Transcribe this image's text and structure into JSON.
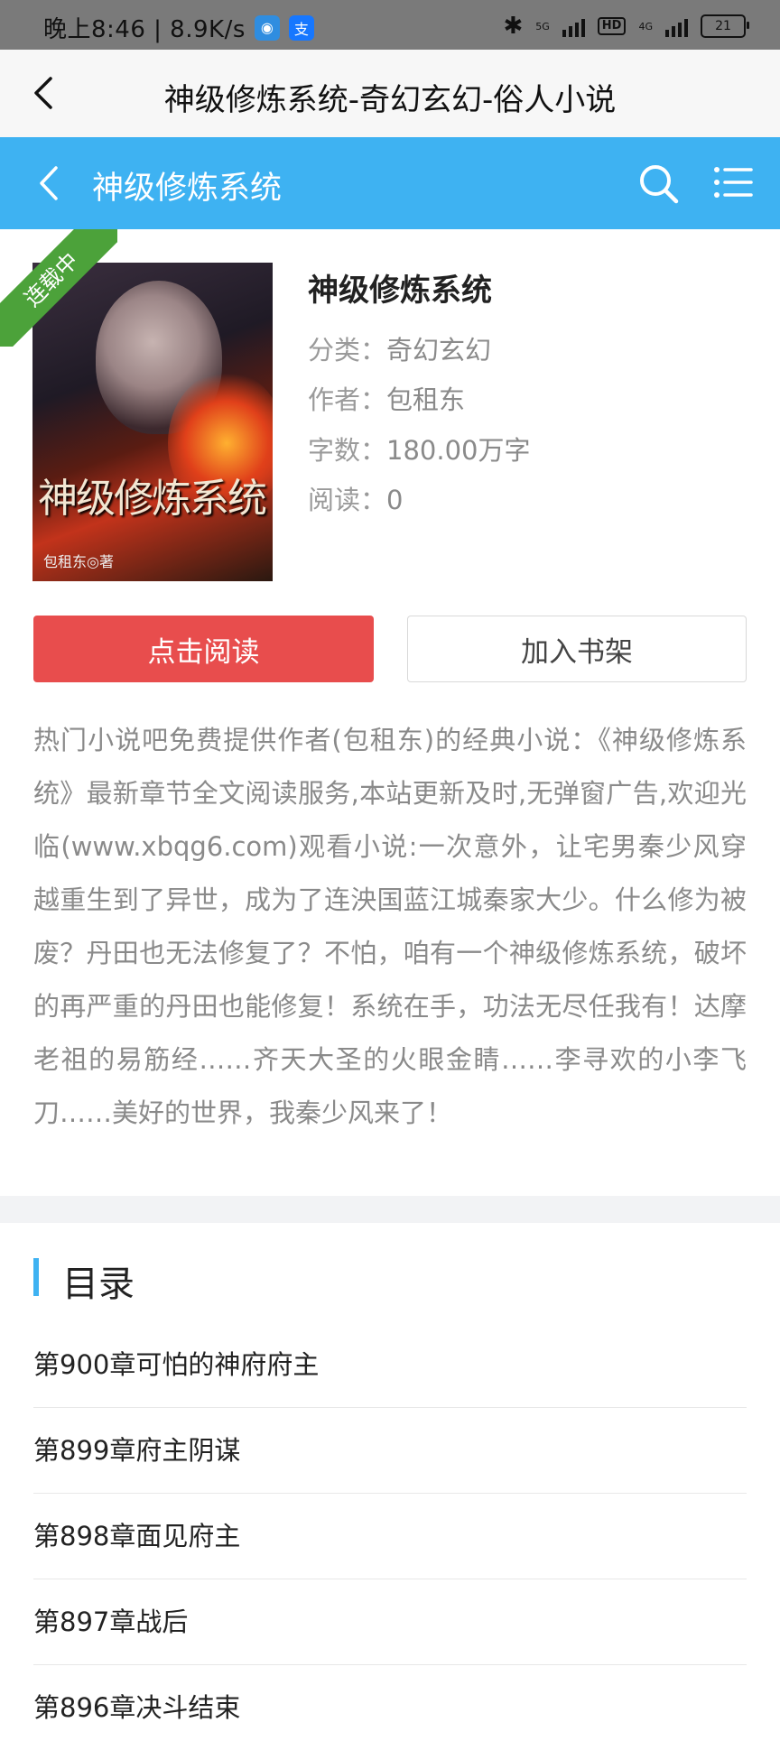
{
  "status_bar": {
    "time_speed": "晚上8:46 | 8.9K/s",
    "network_5g": "5G",
    "hd": "HD",
    "network_4g": "4G",
    "battery": "21"
  },
  "browser": {
    "title": "神级修炼系统-奇幻玄幻-俗人小说"
  },
  "header": {
    "title": "神级修炼系统"
  },
  "book": {
    "status_ribbon": "连载中",
    "cover_title": "神级修炼系统",
    "cover_author": "包租东◎著",
    "name": "神级修炼系统",
    "category_label": "分类：",
    "category": "奇幻玄幻",
    "author_label": "作者：",
    "author": "包租东",
    "words_label": "字数：",
    "words": "180.00万字",
    "reads_label": "阅读：",
    "reads": "0"
  },
  "actions": {
    "read_label": "点击阅读",
    "shelf_label": "加入书架"
  },
  "description": "热门小说吧免费提供作者(包租东)的经典小说：《神级修炼系统》最新章节全文阅读服务,本站更新及时,无弹窗广告,欢迎光临(www.xbqg6.com)观看小说:一次意外，让宅男秦少风穿越重生到了异世，成为了连泱国蓝江城秦家大少。什么修为被废？丹田也无法修复了？不怕，咱有一个神级修炼系统，破坏的再严重的丹田也能修复！系统在手，功法无尽任我有！达摩老祖的易筋经……齐天大圣的火眼金睛……李寻欢的小李飞刀……美好的世界，我秦少风来了！",
  "toc": {
    "heading": "目录",
    "chapters": [
      "第900章可怕的神府府主",
      "第899章府主阴谋",
      "第898章面见府主",
      "第897章战后",
      "第896章决斗结束"
    ]
  },
  "colors": {
    "header_blue": "#3eb2f2",
    "read_button_red": "#e84d4d",
    "ribbon_green": "#4ca23a"
  }
}
